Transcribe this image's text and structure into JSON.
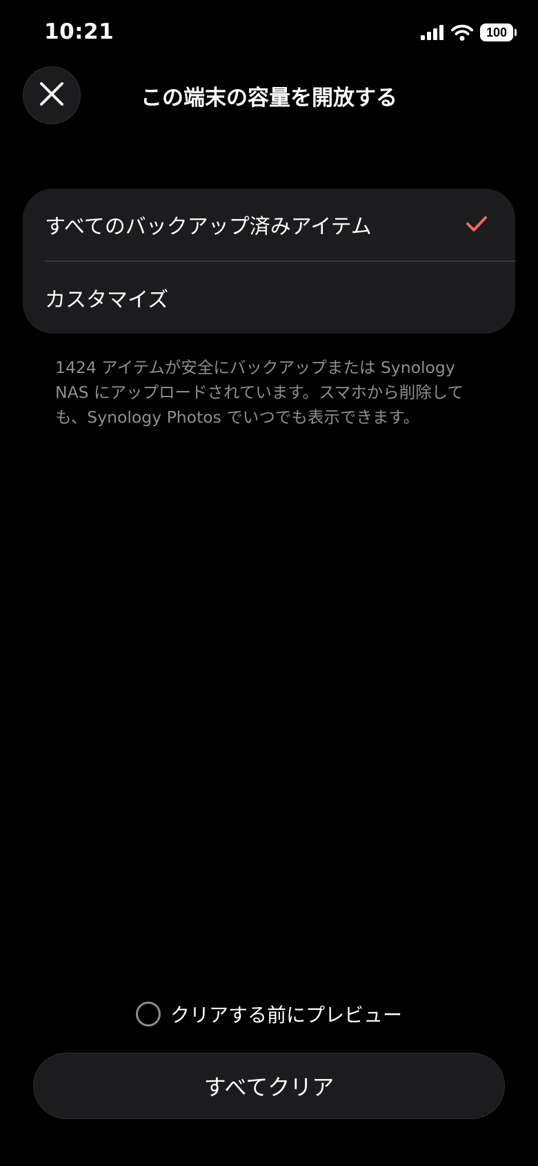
{
  "status_bar": {
    "time": "10:21",
    "battery": "100",
    "icons": [
      "signal-icon",
      "wifi-icon",
      "battery-icon"
    ]
  },
  "header": {
    "close_icon": "close-icon",
    "title": "この端末の容量を開放する"
  },
  "options": [
    {
      "label": "すべてのバックアップ済みアイテム",
      "selected": true,
      "indicator_icon": "checkmark-icon"
    },
    {
      "label": "カスタマイズ",
      "selected": false
    }
  ],
  "description": "1424 アイテムが安全にバックアップまたは Synology NAS にアップロードされています。スマホから削除しても、Synology Photos でいつでも表示できます。",
  "preview": {
    "label": "クリアする前にプレビュー",
    "checked": false
  },
  "primary_button": {
    "label": "すべてクリア"
  },
  "colors": {
    "background": "#000000",
    "surface": "#1c1c1e",
    "accent_check": "#f06a5e",
    "secondary_text": "#8e8e93"
  }
}
